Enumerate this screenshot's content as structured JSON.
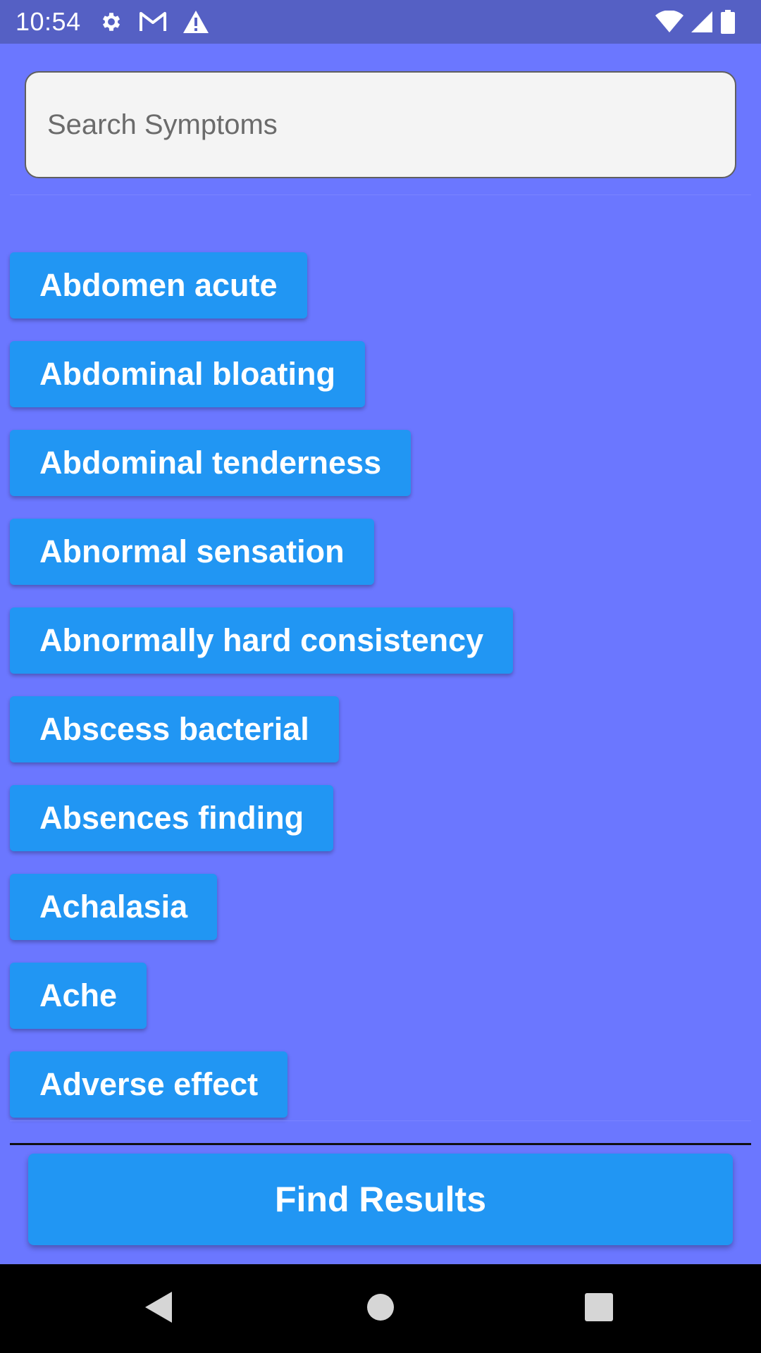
{
  "status_bar": {
    "time": "10:54",
    "left_icons": [
      "gear-icon",
      "gmail-icon",
      "warning-icon"
    ],
    "right_icons": [
      "wifi-icon",
      "cell-signal-icon",
      "battery-icon"
    ],
    "background": "#5560c4"
  },
  "search": {
    "placeholder": "Search Symptoms",
    "value": ""
  },
  "symptoms": [
    "Abdomen acute",
    "Abdominal bloating",
    "Abdominal tenderness",
    "Abnormal sensation",
    "Abnormally hard consistency",
    "Abscess bacterial",
    "Absences finding",
    "Achalasia",
    "Ache",
    "Adverse effect"
  ],
  "actions": {
    "find_results_label": "Find Results"
  },
  "nav_bar": {
    "buttons": [
      "back-icon",
      "home-icon",
      "recents-icon"
    ]
  },
  "colors": {
    "page_background": "#6b77ff",
    "chip_background": "#2196f3",
    "chip_text": "#ffffff",
    "search_background": "#f4f4f4"
  }
}
